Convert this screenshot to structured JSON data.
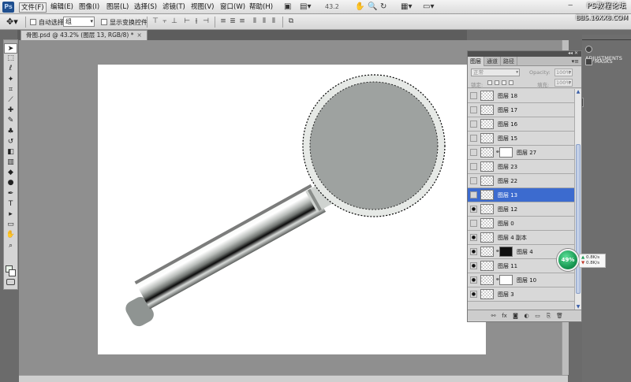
{
  "app": {
    "logo": "Ps",
    "menu": [
      "文件(F)",
      "编辑(E)",
      "图像(I)",
      "图层(L)",
      "选择(S)",
      "滤镜(T)",
      "视图(V)",
      "窗口(W)",
      "帮助(H)"
    ],
    "zoom": "43.2",
    "brand": "PS教程论坛",
    "brand_url": "BBS.16XX8.COM"
  },
  "options": {
    "auto_select_label": "自动选择:",
    "auto_select_value": "组",
    "show_transform_label": "显示变换控件"
  },
  "document": {
    "tab_title": "骨图.psd @ 43.2% (图层 13, RGB/8) *",
    "close": "×"
  },
  "tools": [
    "move",
    "marquee",
    "lasso",
    "magic-wand",
    "crop",
    "eyedropper",
    "healing",
    "brush",
    "clone-stamp",
    "history-brush",
    "eraser",
    "gradient",
    "blur",
    "dodge",
    "pen",
    "type",
    "path-select",
    "shape",
    "hand",
    "zoom"
  ],
  "colors": {
    "ui_bg": "#6b6b6b",
    "canvas": "#ffffff",
    "selection_blue": "#3c6bcf",
    "art_gray": "#9ea2a0"
  },
  "layers_panel": {
    "tabs": [
      "图层",
      "通道",
      "路径"
    ],
    "blend_mode": "正常",
    "opacity_label": "Opacity:",
    "opacity_value": "100%",
    "lock_label": "锁定:",
    "fill_label": "填充:",
    "fill_value": "100%",
    "layers": [
      {
        "name": "图层 18",
        "visible": false,
        "mask": "none",
        "selected": false
      },
      {
        "name": "图层 17",
        "visible": false,
        "mask": "none",
        "selected": false
      },
      {
        "name": "图层 16",
        "visible": false,
        "mask": "none",
        "selected": false
      },
      {
        "name": "图层 15",
        "visible": false,
        "mask": "none",
        "selected": false
      },
      {
        "name": "图层 27",
        "visible": false,
        "mask": "white",
        "selected": false
      },
      {
        "name": "图层 23",
        "visible": false,
        "mask": "none",
        "selected": false
      },
      {
        "name": "图层 22",
        "visible": false,
        "mask": "none",
        "selected": false
      },
      {
        "name": "图层 13",
        "visible": false,
        "mask": "none",
        "selected": true
      },
      {
        "name": "图层 12",
        "visible": true,
        "mask": "none",
        "selected": false
      },
      {
        "name": "图层 0",
        "visible": false,
        "mask": "none",
        "selected": false
      },
      {
        "name": "图层 4 副本",
        "visible": true,
        "mask": "none",
        "selected": false
      },
      {
        "name": "图层 4",
        "visible": true,
        "mask": "dark",
        "selected": false
      },
      {
        "name": "图层 11",
        "visible": true,
        "mask": "none",
        "selected": false
      },
      {
        "name": "图层 10",
        "visible": true,
        "mask": "white",
        "selected": false
      },
      {
        "name": "图层 3",
        "visible": true,
        "mask": "none",
        "selected": false
      }
    ]
  },
  "dock": {
    "adjustments": "ADJUSTMENTS",
    "masks": "MASKS"
  },
  "speed_widget": {
    "percent": "49%",
    "up": "0.8K/s",
    "down": "0.8K/s"
  }
}
